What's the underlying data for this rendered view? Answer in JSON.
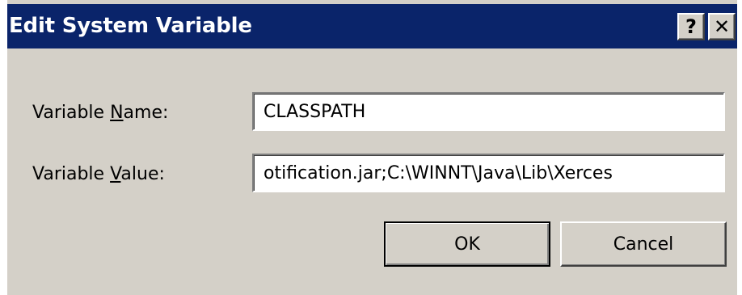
{
  "window": {
    "title": "Edit System Variable",
    "help_glyph": "?",
    "close_glyph": "✕",
    "titlebar_color": "#0a246a",
    "face_color": "#d4d0c8"
  },
  "fields": {
    "name": {
      "label_before": "Variable ",
      "label_accel": "N",
      "label_after": "ame:",
      "value": "CLASSPATH"
    },
    "value": {
      "label_before": "Variable ",
      "label_accel": "V",
      "label_after": "alue:",
      "value": "otification.jar;C:\\WINNT\\Java\\Lib\\Xerces"
    }
  },
  "buttons": {
    "ok": "OK",
    "cancel": "Cancel"
  }
}
